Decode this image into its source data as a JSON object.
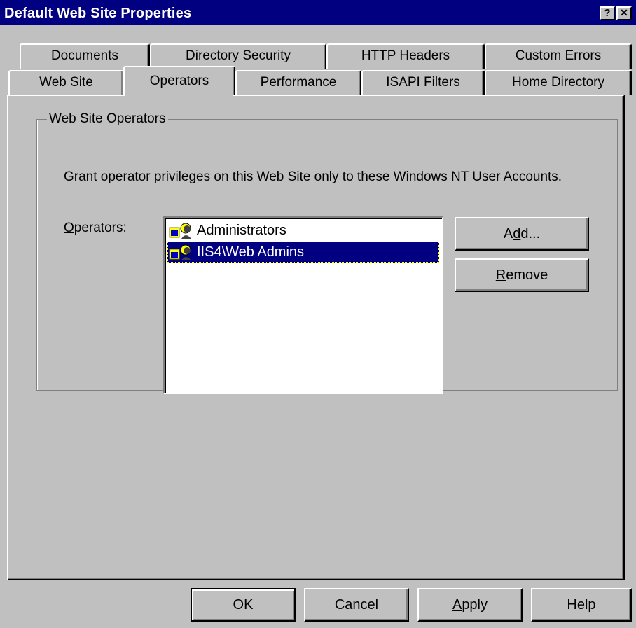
{
  "window": {
    "title": "Default Web Site Properties",
    "help_button": "?",
    "close_button": "✕"
  },
  "tabs": {
    "row1": [
      "Documents",
      "Directory Security",
      "HTTP Headers",
      "Custom Errors"
    ],
    "row2": [
      "Web Site",
      "Operators",
      "Performance",
      "ISAPI Filters",
      "Home Directory"
    ],
    "active": "Operators"
  },
  "group": {
    "title": "Web Site Operators",
    "description": "Grant operator privileges on this Web Site only to these Windows NT User Accounts.",
    "operators_label_mnemonic": "O",
    "operators_label_rest": "perators:",
    "operators": [
      {
        "name": "Administrators",
        "selected": false
      },
      {
        "name": "IIS4\\Web Admins",
        "selected": true
      }
    ],
    "add_button": {
      "before": "A",
      "mnemonic": "d",
      "after": "d..."
    },
    "remove_button": {
      "before": "",
      "mnemonic": "R",
      "after": "emove"
    }
  },
  "footer": {
    "ok": "OK",
    "cancel": "Cancel",
    "apply_mnemonic": "A",
    "apply_rest": "pply",
    "help": "Help"
  }
}
